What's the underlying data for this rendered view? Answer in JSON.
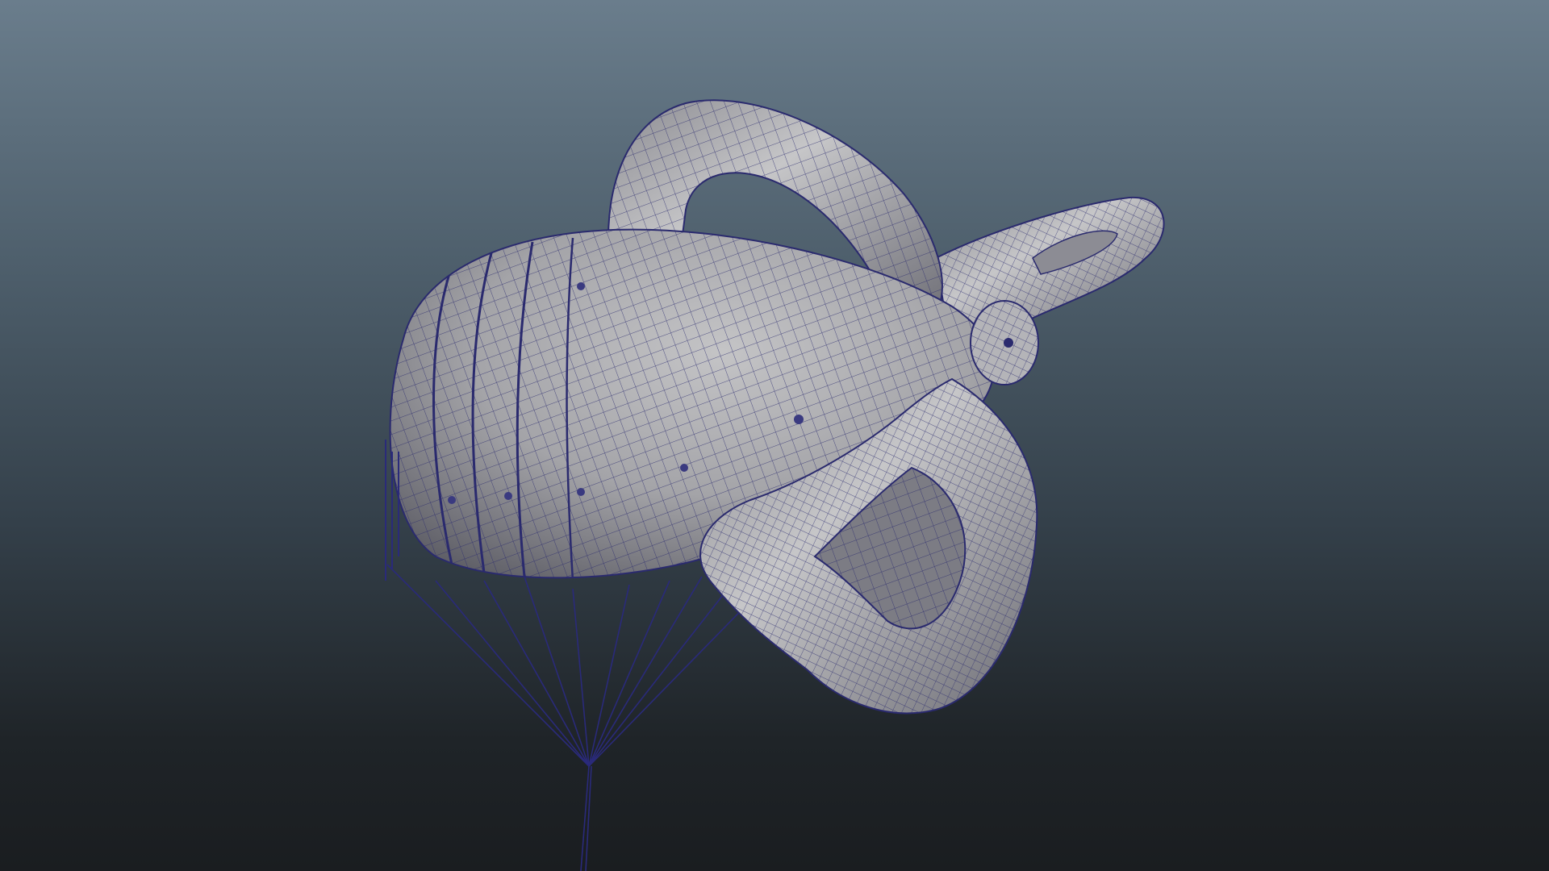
{
  "viewport": {
    "background_top": "#6a7d8c",
    "background_bottom": "#1a1d20"
  },
  "model": {
    "surface_color": "#a8a8aa",
    "surface_shadow": "#5c5c62",
    "wireframe_color": "#2a2a6e",
    "icon": "wireframe-balloon-model"
  }
}
